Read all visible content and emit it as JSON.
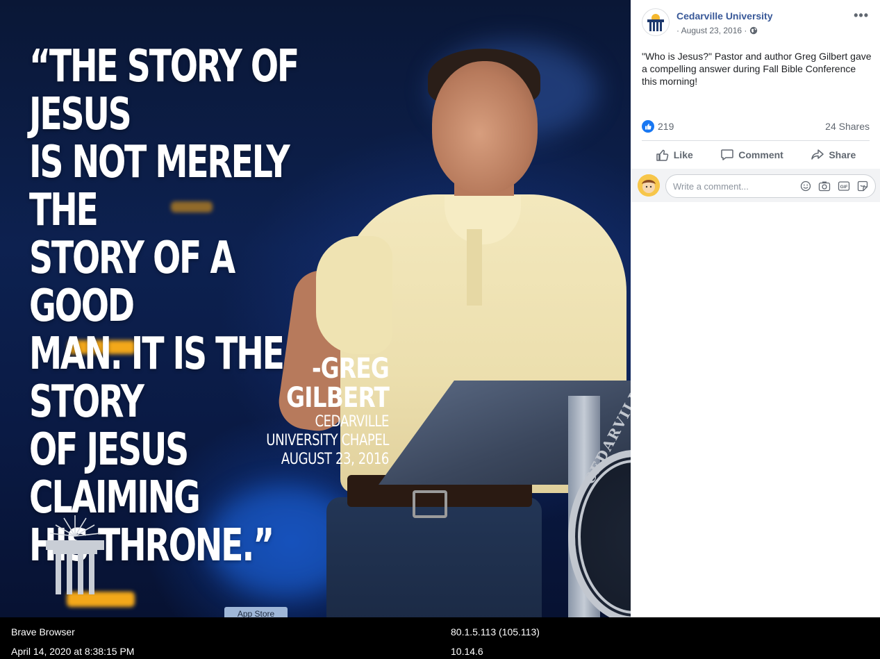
{
  "photo": {
    "quote": "“THE STORY OF JESUS\nIS NOT MERELY THE\nSTORY OF A GOOD\nMAN. IT IS THE STORY\nOF JESUS CLAIMING\nHIS THRONE.”",
    "attribution_name": "-GREG GILBERT",
    "attribution_event": "CEDARVILLE UNIVERSITY CHAPEL",
    "attribution_date": "AUGUST 23, 2016",
    "seal_text": "CEDARVILLE",
    "app_store_label": "App Store"
  },
  "post": {
    "page_name": "Cedarville University",
    "date": "· August 23, 2016 ·",
    "more_label": "•••",
    "text": "\"Who is Jesus?\" Pastor and author Greg Gilbert gave a compelling answer during Fall Bible Conference this morning!",
    "like_count": "219",
    "shares": "24 Shares",
    "actions": {
      "like": "Like",
      "comment": "Comment",
      "share": "Share"
    },
    "comment_placeholder": "Write a comment..."
  },
  "meta_bar": {
    "browser": "Brave Browser",
    "timestamp": "April 14, 2020 at 8:38:15 PM",
    "version": "80.1.5.113 (105.113)",
    "os_version": "10.14.6"
  },
  "colors": {
    "link_blue": "#385898",
    "like_blue": "#1877f2",
    "logo_gold": "#f5b82e",
    "logo_navy": "#1f3a6e"
  }
}
